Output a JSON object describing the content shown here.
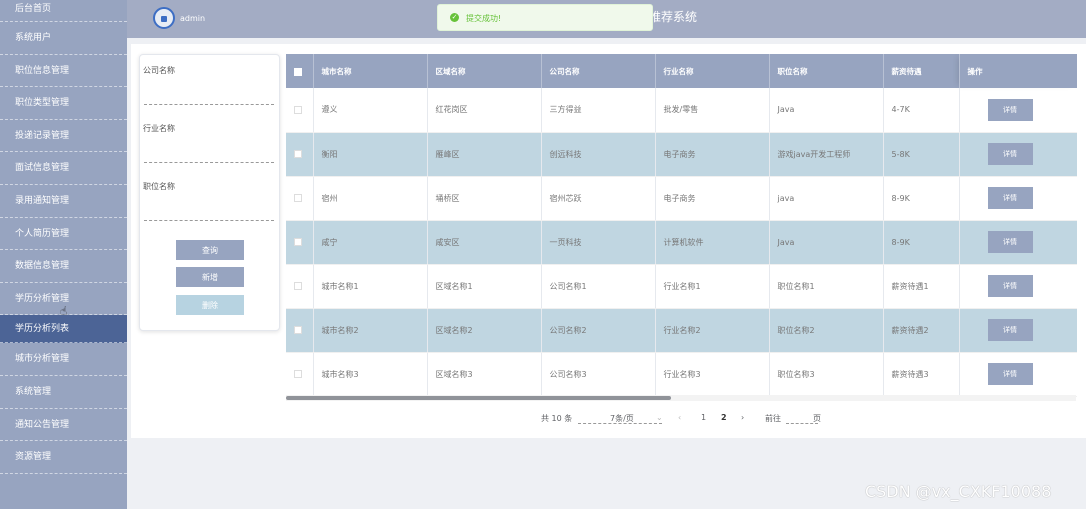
{
  "header": {
    "username": "admin",
    "system_title": "推荐系统"
  },
  "toast": {
    "message": "提交成功!"
  },
  "sidebar": {
    "items": [
      {
        "label": "后台首页"
      },
      {
        "label": "系统用户"
      },
      {
        "label": "职位信息管理"
      },
      {
        "label": "职位类型管理"
      },
      {
        "label": "投递记录管理"
      },
      {
        "label": "面试信息管理"
      },
      {
        "label": "录用通知管理"
      },
      {
        "label": "个人简历管理"
      },
      {
        "label": "数据信息管理"
      },
      {
        "label": "学历分析管理"
      },
      {
        "label": "学历分析列表"
      },
      {
        "label": "城市分析管理"
      },
      {
        "label": "系统管理"
      },
      {
        "label": "通知公告管理"
      },
      {
        "label": "资源管理"
      }
    ]
  },
  "filter": {
    "company_label": "公司名称",
    "company_value": "",
    "industry_label": "行业名称",
    "industry_value": "",
    "position_label": "职位名称",
    "position_value": "",
    "query_button": "查询",
    "add_button": "新增",
    "delete_button": "删除"
  },
  "table": {
    "columns": [
      "城市名称",
      "区域名称",
      "公司名称",
      "行业名称",
      "职位名称",
      "薪资待遇",
      "操作"
    ],
    "detail_label": "详情",
    "rows": [
      [
        "遵义",
        "红花岗区",
        "三方得益",
        "批发/零售",
        "Java",
        "4-7K"
      ],
      [
        "衡阳",
        "雁峰区",
        "创远科技",
        "电子商务",
        "游戏java开发工程师",
        "5-8K"
      ],
      [
        "宿州",
        "埇桥区",
        "宿州芯跃",
        "电子商务",
        "java",
        "8-9K"
      ],
      [
        "咸宁",
        "咸安区",
        "一页科技",
        "计算机软件",
        "Java",
        "8-9K"
      ],
      [
        "城市名称1",
        "区域名称1",
        "公司名称1",
        "行业名称1",
        "职位名称1",
        "薪资待遇1"
      ],
      [
        "城市名称2",
        "区域名称2",
        "公司名称2",
        "行业名称2",
        "职位名称2",
        "薪资待遇2"
      ],
      [
        "城市名称3",
        "区域名称3",
        "公司名称3",
        "行业名称3",
        "职位名称3",
        "薪资待遇3"
      ]
    ]
  },
  "pagination": {
    "total": "共 10 条",
    "page_size": "7条/页",
    "pages": [
      "1",
      "2"
    ],
    "goto_label": "前往",
    "page_suffix": "页"
  },
  "watermark": "CSDN @vx_CXKF10088"
}
